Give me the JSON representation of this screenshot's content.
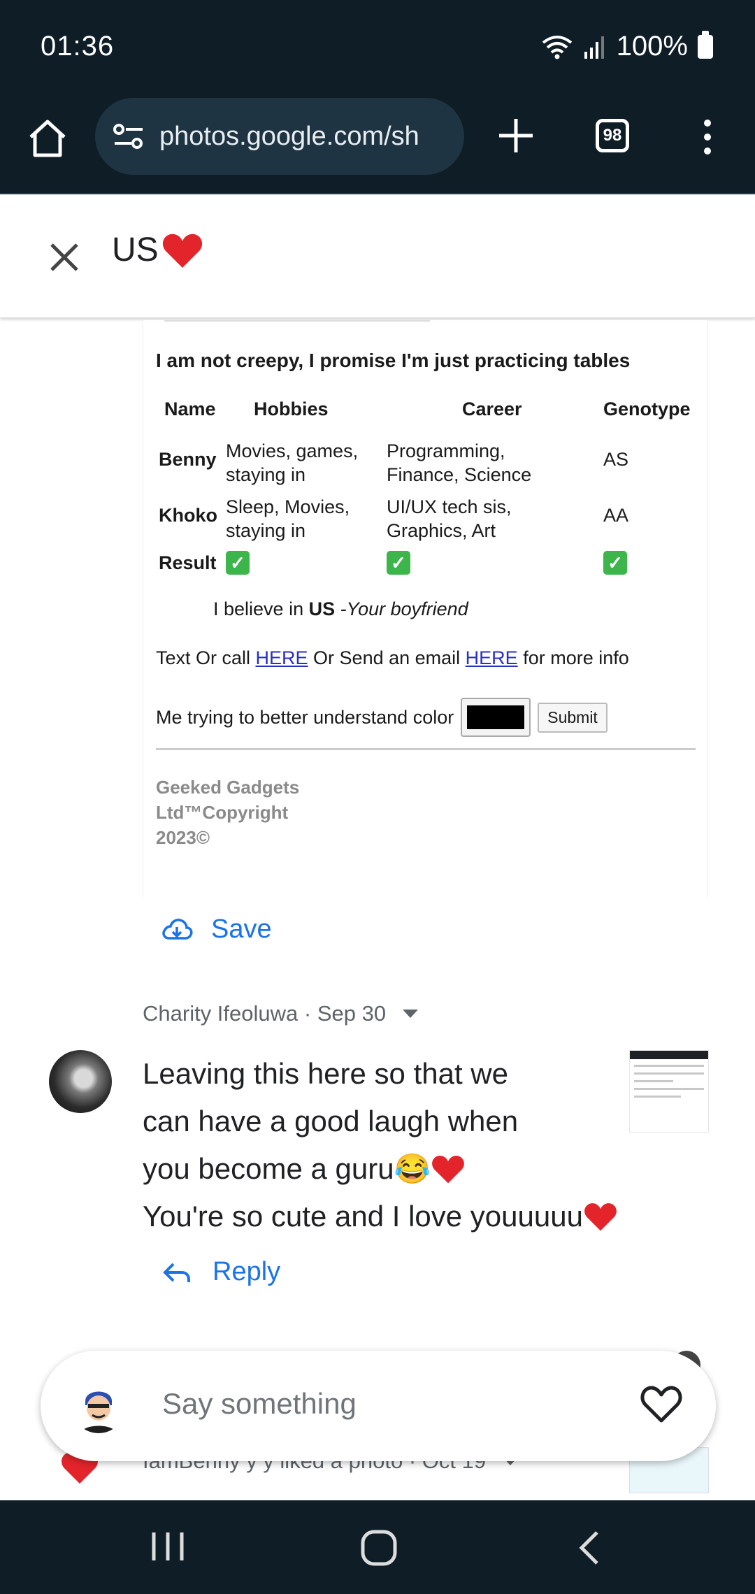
{
  "status_bar": {
    "time": "01:36",
    "battery": "100%"
  },
  "browser": {
    "url": "photos.google.com/sh",
    "tab_count": "98"
  },
  "album": {
    "title": "US"
  },
  "photo": {
    "title": "I am not creepy, I promise I'm just practicing tables",
    "table": {
      "headers": [
        "Name",
        "Hobbies",
        "Career",
        "Genotype"
      ],
      "rows": [
        [
          "Benny",
          "Movies, games, staying in",
          "Programming, Finance, Science",
          "AS"
        ],
        [
          "Khoko",
          "Sleep, Movies, staying in",
          "UI/UX tech sis, Graphics, Art",
          "AA"
        ]
      ],
      "result_label": "Result"
    },
    "believe_prefix": "I believe in ",
    "believe_bold": "US",
    "believe_suffix": " -Your boyfriend",
    "contact_1": "Text Or call ",
    "contact_link_1": "HERE",
    "contact_2": " Or Send an email ",
    "contact_link_2": "HERE",
    "contact_3": " for more info",
    "color_label": "Me trying to better understand color",
    "submit_label": "Submit",
    "footer": "Geeked Gadgets Ltd™Copyright 2023©"
  },
  "save_label": "Save",
  "comment": {
    "author_line": "Charity Ifeoluwa · Sep 30",
    "line1": "Leaving this here so that we",
    "line2": "can have a good laugh when",
    "line3": "you become a guru😂",
    "line4": "You're so cute and I love youuuuu"
  },
  "reply_label": "Reply",
  "activity": "IamBenny y y liked a photo · Oct 19",
  "compose": {
    "placeholder": "Say something"
  },
  "colors": {
    "chrome": "#0f1d27",
    "accent": "#1a73e8",
    "heart": "#e3242b"
  }
}
